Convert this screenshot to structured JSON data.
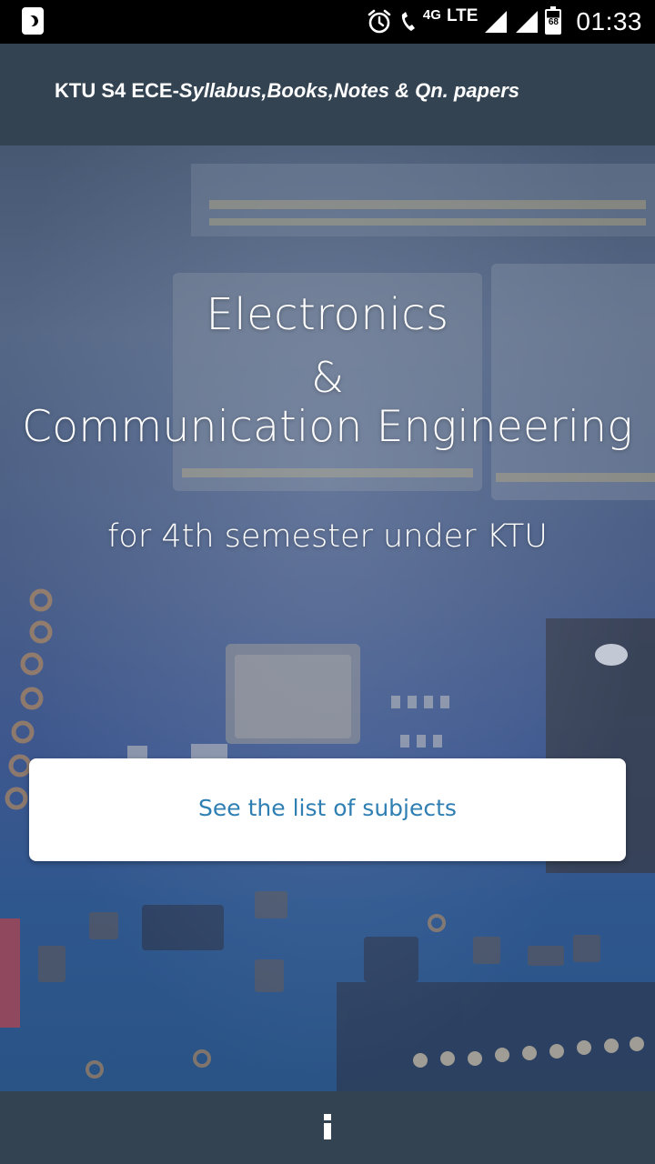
{
  "status_bar": {
    "network_sub": "4G",
    "network": "LTE",
    "battery_level": "68",
    "time": "01:33",
    "icons": [
      "moon-icon",
      "alarm-icon",
      "volte-call-icon",
      "signal-icon",
      "battery-icon"
    ]
  },
  "app_bar": {
    "title_plain": "KTU S4 ECE-",
    "title_italic": "Syllabus,Books,Notes & Qn. papers"
  },
  "hero": {
    "line1": "Electronics",
    "line2": "&",
    "line3": "Communication Engineering",
    "subtitle": "for 4th semester under KTU",
    "cta_label": "See the list of subjects"
  },
  "bottom_bar": {
    "info_icon": "info-icon"
  },
  "colors": {
    "app_bar_bg": "#334352",
    "cta_text": "#2f7fb3",
    "button_bg": "#ffffff"
  }
}
